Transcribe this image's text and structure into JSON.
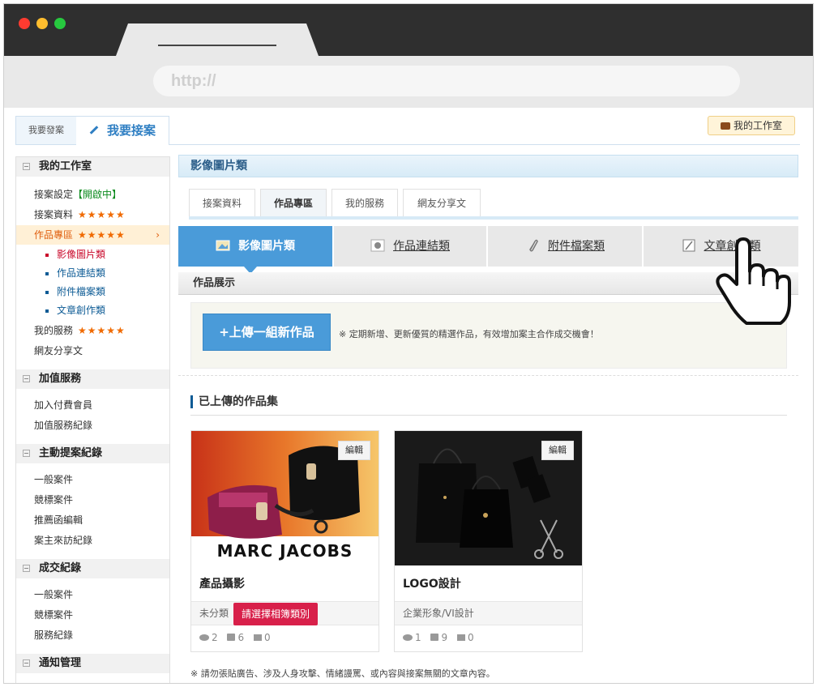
{
  "browser": {
    "url_text": "http://"
  },
  "top_tabs": {
    "post": "我要發案",
    "take": "我要接案"
  },
  "studio_button": "我的工作室",
  "sidebar": {
    "workspace_title": "我的工作室",
    "case_setting": "接案設定",
    "case_status": "【開啟中】",
    "case_data": "接案資料",
    "portfolio": "作品專區",
    "sub_image": "影像圖片類",
    "sub_link": "作品連結類",
    "sub_file": "附件檔案類",
    "sub_article": "文章創作類",
    "my_services": "我的服務",
    "share": "網友分享文",
    "stars": "★★★★★",
    "value_title": "加值服務",
    "join_paid": "加入付費會員",
    "value_record": "加值服務紀錄",
    "proposal_title": "主動提案紀錄",
    "general_case": "一般案件",
    "bid_case": "競標案件",
    "recommend_edit": "推薦函編輯",
    "client_visit": "案主來訪紀錄",
    "deal_title": "成交紀錄",
    "deal_general": "一般案件",
    "deal_bid": "競標案件",
    "service_record": "服務紀錄",
    "notice_title": "通知管理"
  },
  "main": {
    "title": "影像圖片類",
    "subtabs": [
      "接案資料",
      "作品專區",
      "我的服務",
      "網友分享文"
    ],
    "category_tabs": [
      "影像圖片類",
      "作品連結類",
      "附件檔案類",
      "文章創作類"
    ],
    "section_title": "作品展示",
    "upload_button": "+上傳一組新作品",
    "upload_note": "※ 定期新增、更新優質的精選作品，有效增加案主合作成交機會！",
    "collection_title": "已上傳的作品集",
    "footnote": "※ 請勿張貼廣告、涉及人身攻擊、情緒謾罵、或內容與接案無關的文章內容。"
  },
  "cards": [
    {
      "edit": "編輯",
      "title": "產品攝影",
      "category": "未分類",
      "pick": "請選擇相簿類別",
      "views": "2",
      "likes": "6",
      "comments": "0",
      "brand": "MARC JACOBS"
    },
    {
      "edit": "編輯",
      "title": "LOGO設計",
      "category": "企業形象/VI設計",
      "views": "1",
      "likes": "9",
      "comments": "0"
    }
  ],
  "colors": {
    "accent": "#4a9bd9",
    "active": "#e06010",
    "link": "#0d5b95",
    "pick": "#d8204a"
  }
}
